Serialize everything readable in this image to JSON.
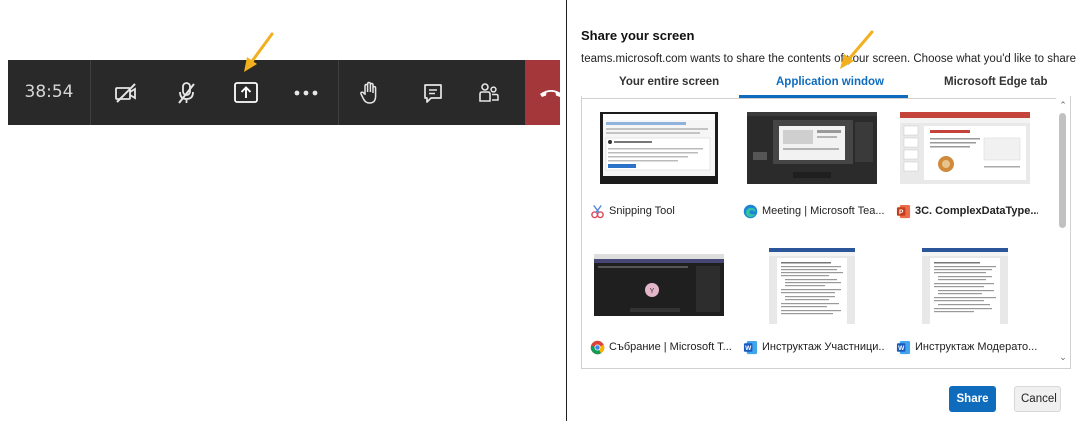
{
  "meeting_toolbar": {
    "timer": "38:54",
    "buttons": [
      {
        "name": "camera-off-icon"
      },
      {
        "name": "mic-off-icon"
      },
      {
        "name": "share-screen-icon"
      },
      {
        "name": "more-options-icon"
      },
      {
        "name": "raise-hand-icon"
      },
      {
        "name": "chat-icon"
      },
      {
        "name": "participants-icon"
      }
    ],
    "hangup_icon": "phone-hangup-icon",
    "colors": {
      "bar": "#292929",
      "hangup": "#a4373a",
      "arrow": "#f2b01e"
    }
  },
  "share_dialog": {
    "title": "Share your screen",
    "subtitle": "teams.microsoft.com wants to share the contents of your screen. Choose what you'd like to share.",
    "tabs": [
      {
        "label": "Your entire screen",
        "active": false
      },
      {
        "label": "Application window",
        "active": true
      },
      {
        "label": "Microsoft Edge tab",
        "active": false
      }
    ],
    "windows": [
      {
        "label": "Snipping Tool",
        "app_icon": "snipping-tool-icon"
      },
      {
        "label": "Meeting | Microsoft Tea...",
        "app_icon": "edge-icon"
      },
      {
        "label": "3C. ComplexDataType...",
        "app_icon": "powerpoint-icon"
      },
      {
        "label": "Събрание | Microsoft T...",
        "app_icon": "chrome-icon"
      },
      {
        "label": "Инструктаж Участници...",
        "app_icon": "word-icon"
      },
      {
        "label": "Инструктаж Модерато...",
        "app_icon": "word-icon"
      }
    ],
    "buttons": {
      "share": "Share",
      "cancel": "Cancel"
    },
    "accent": "#0f6cbd"
  }
}
